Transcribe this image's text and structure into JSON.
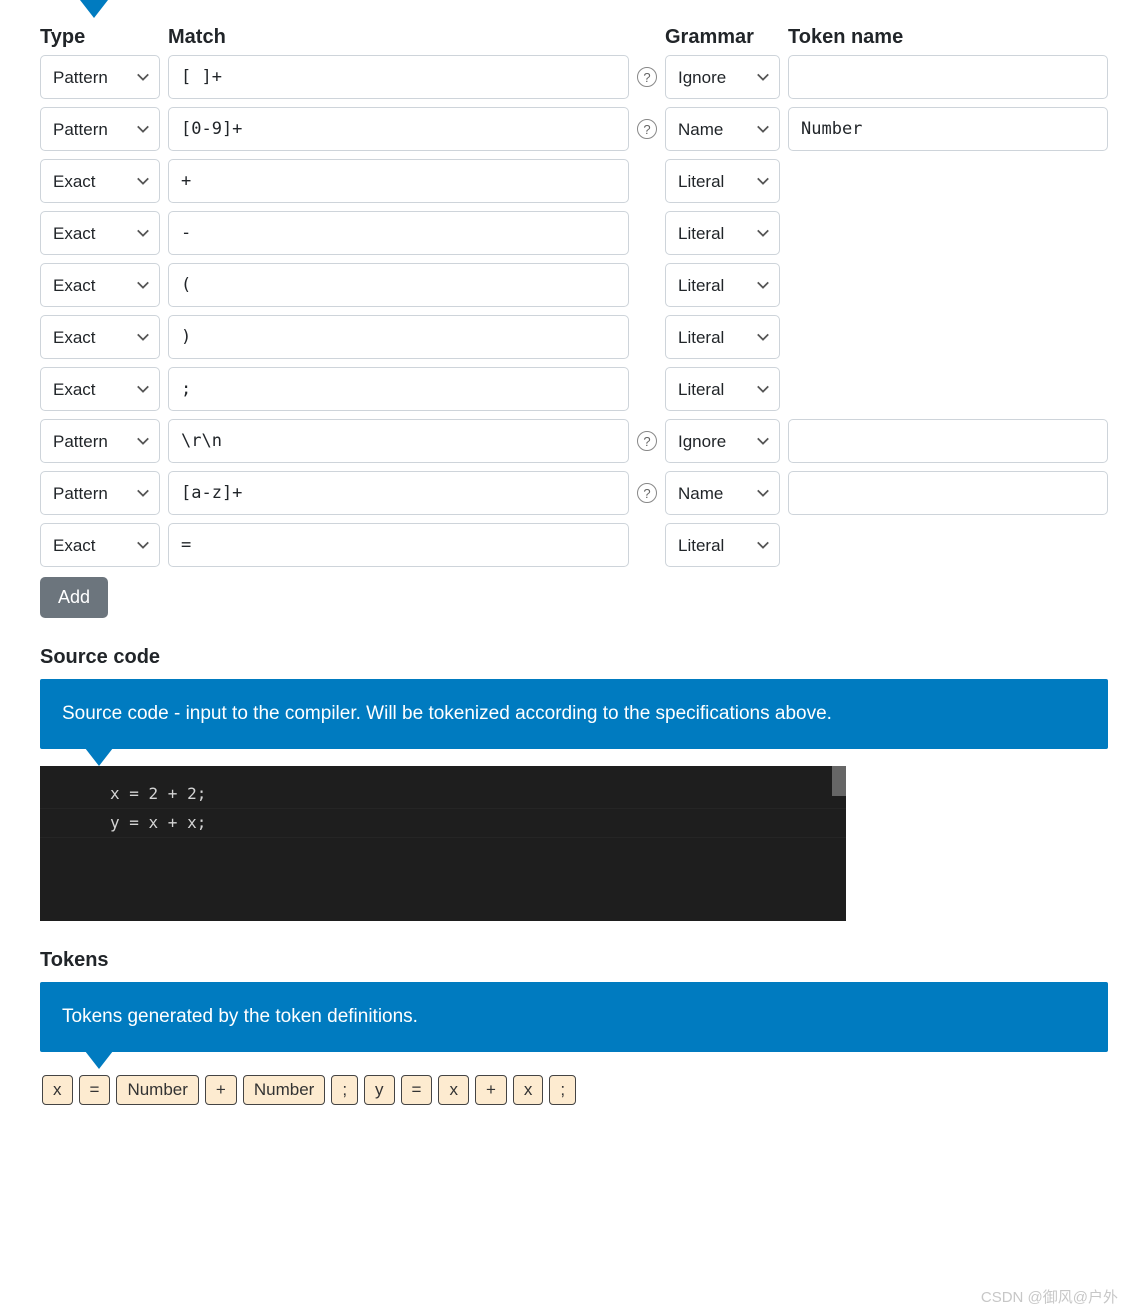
{
  "headers": {
    "type": "Type",
    "match": "Match",
    "grammar": "Grammar",
    "token": "Token name"
  },
  "rules": [
    {
      "type": "Pattern",
      "match": "[ ]+",
      "help": true,
      "grammar": "Ignore",
      "token": ""
    },
    {
      "type": "Pattern",
      "match": "[0-9]+",
      "help": true,
      "grammar": "Name",
      "token": "Number"
    },
    {
      "type": "Exact",
      "match": "+",
      "help": false,
      "grammar": "Literal",
      "token": null
    },
    {
      "type": "Exact",
      "match": "-",
      "help": false,
      "grammar": "Literal",
      "token": null
    },
    {
      "type": "Exact",
      "match": "(",
      "help": false,
      "grammar": "Literal",
      "token": null
    },
    {
      "type": "Exact",
      "match": ")",
      "help": false,
      "grammar": "Literal",
      "token": null
    },
    {
      "type": "Exact",
      "match": ";",
      "help": false,
      "grammar": "Literal",
      "token": null
    },
    {
      "type": "Pattern",
      "match": "\\r\\n",
      "help": true,
      "grammar": "Ignore",
      "token": ""
    },
    {
      "type": "Pattern",
      "match": "[a-z]+",
      "help": true,
      "grammar": "Name",
      "token": ""
    },
    {
      "type": "Exact",
      "match": "=",
      "help": false,
      "grammar": "Literal",
      "token": null
    }
  ],
  "typeOptions": [
    "Pattern",
    "Exact"
  ],
  "grammarOptions": [
    "Ignore",
    "Name",
    "Literal"
  ],
  "addButton": "Add",
  "sections": {
    "sourceTitle": "Source code",
    "sourceInfo": "Source code - input to the compiler. Will be tokenized according to the specifications above.",
    "tokensTitle": "Tokens",
    "tokensInfo": "Tokens generated by the token definitions."
  },
  "sourceLines": [
    "x = 2 + 2;",
    "y = x + x;"
  ],
  "tokens": [
    "x",
    "=",
    "Number",
    "+",
    "Number",
    ";",
    "y",
    "=",
    "x",
    "+",
    "x",
    ";"
  ],
  "watermark": "CSDN @御风@户外"
}
